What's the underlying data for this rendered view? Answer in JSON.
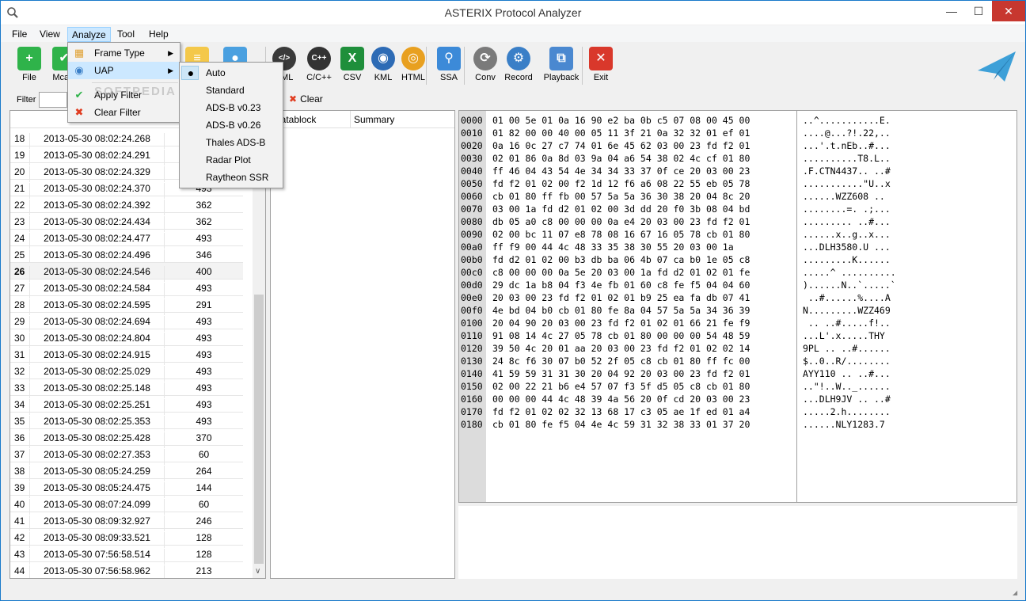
{
  "window": {
    "title": "ASTERIX Protocol Analyzer",
    "minimize": "—",
    "maximize": "☐",
    "close": "✕"
  },
  "menu": [
    "File",
    "View",
    "Analyze",
    "Tool",
    "Help"
  ],
  "toolbar": [
    {
      "label": "File",
      "color": "#2fb34a",
      "glyph": "+"
    },
    {
      "label": "Mcast",
      "color": "#2fb34a",
      "glyph": "✔"
    },
    {
      "label": "",
      "color": "#f4c84a",
      "glyph": "≡"
    },
    {
      "label": "",
      "color": "#4aa0e0",
      "glyph": "●"
    },
    {
      "label": "XML",
      "color": "#3a3a3a",
      "glyph": "</>"
    },
    {
      "label": "C/C++",
      "color": "#333333",
      "glyph": "C++"
    },
    {
      "label": "CSV",
      "color": "#1f8f3b",
      "glyph": "X"
    },
    {
      "label": "KML",
      "color": "#2d6bb5",
      "glyph": "◉"
    },
    {
      "label": "HTML",
      "color": "#e8a020",
      "glyph": "◎"
    },
    {
      "label": "SSA",
      "color": "#3c8ad8",
      "glyph": "⚲"
    },
    {
      "label": "Conv",
      "color": "#7a7a7a",
      "glyph": "⟳"
    },
    {
      "label": "Record",
      "color": "#3a7fc7",
      "glyph": "⚙"
    },
    {
      "label": "Playback",
      "color": "#4a88d0",
      "glyph": "⧉"
    },
    {
      "label": "Exit",
      "color": "#d9382b",
      "glyph": "✕"
    }
  ],
  "filter": {
    "label": "Filter",
    "value": "",
    "clear_label": "Clear"
  },
  "packet_table": {
    "rows": [
      [
        "18",
        "2013-05-30 08:02:24.268",
        ""
      ],
      [
        "19",
        "2013-05-30 08:02:24.291",
        ""
      ],
      [
        "20",
        "2013-05-30 08:02:24.329",
        ""
      ],
      [
        "21",
        "2013-05-30 08:02:24.370",
        "493"
      ],
      [
        "22",
        "2013-05-30 08:02:24.392",
        "362"
      ],
      [
        "23",
        "2013-05-30 08:02:24.434",
        "362"
      ],
      [
        "24",
        "2013-05-30 08:02:24.477",
        "493"
      ],
      [
        "25",
        "2013-05-30 08:02:24.496",
        "346"
      ],
      [
        "26",
        "2013-05-30 08:02:24.546",
        "400"
      ],
      [
        "27",
        "2013-05-30 08:02:24.584",
        "493"
      ],
      [
        "28",
        "2013-05-30 08:02:24.595",
        "291"
      ],
      [
        "29",
        "2013-05-30 08:02:24.694",
        "493"
      ],
      [
        "30",
        "2013-05-30 08:02:24.804",
        "493"
      ],
      [
        "31",
        "2013-05-30 08:02:24.915",
        "493"
      ],
      [
        "32",
        "2013-05-30 08:02:25.029",
        "493"
      ],
      [
        "33",
        "2013-05-30 08:02:25.148",
        "493"
      ],
      [
        "34",
        "2013-05-30 08:02:25.251",
        "493"
      ],
      [
        "35",
        "2013-05-30 08:02:25.353",
        "493"
      ],
      [
        "36",
        "2013-05-30 08:02:25.428",
        "370"
      ],
      [
        "37",
        "2013-05-30 08:02:27.353",
        "60"
      ],
      [
        "38",
        "2013-05-30 08:05:24.259",
        "264"
      ],
      [
        "39",
        "2013-05-30 08:05:24.475",
        "144"
      ],
      [
        "40",
        "2013-05-30 08:07:24.099",
        "60"
      ],
      [
        "41",
        "2013-05-30 08:09:32.927",
        "246"
      ],
      [
        "42",
        "2013-05-30 08:09:33.521",
        "128"
      ],
      [
        "43",
        "2013-05-30 07:56:58.514",
        "128"
      ],
      [
        "44",
        "2013-05-30 07:56:58.962",
        "213"
      ]
    ],
    "selected": "26"
  },
  "datablock_table": {
    "headers": [
      "Datablock",
      "Summary"
    ]
  },
  "hexdump": [
    [
      "0000",
      "01 00 5e 01 0a 16 90 e2 ba 0b c5 07 08 00 45 00",
      "..^...........E."
    ],
    [
      "0010",
      "01 82 00 00 40 00 05 11 3f 21 0a 32 32 01 ef 01",
      "....@...?!.22,.."
    ],
    [
      "0020",
      "0a 16 0c 27 c7 74 01 6e 45 62 03 00 23 fd f2 01",
      "...'.t.nEb..#..."
    ],
    [
      "0030",
      "02 01 86 0a 8d 03 9a 04 a6 54 38 02 4c cf 01 80",
      "..........T8.L.."
    ],
    [
      "0040",
      "ff 46 04 43 54 4e 34 34 33 37 0f ce 20 03 00 23",
      ".F.CTN4437.. ..#"
    ],
    [
      "0050",
      "fd f2 01 02 00 f2 1d 12 f6 a6 08 22 55 eb 05 78",
      "...........\"U..x"
    ],
    [
      "0060",
      "cb 01 80 ff fb 00 57 5a 5a 36 30 38 20 04 8c 20",
      "......WZZ608 .. "
    ],
    [
      "0070",
      "03 00 1a fd d2 01 02 00 3d dd 20 f0 3b 08 04 bd",
      "........=. .;..."
    ],
    [
      "0080",
      "db 05 a0 c8 00 00 00 0a e4 20 03 00 23 fd f2 01",
      "......... ..#..."
    ],
    [
      "0090",
      "02 00 bc 11 07 e8 78 08 16 67 16 05 78 cb 01 80",
      "......x..g..x..."
    ],
    [
      "00a0",
      "ff f9 00 44 4c 48 33 35 38 30 55 20 03 00 1a",
      "...DLH3580.U ..."
    ],
    [
      "00b0",
      "fd d2 01 02 00 b3 db ba 06 4b 07 ca b0 1e 05 c8",
      ".........K......"
    ],
    [
      "00c0",
      "c8 00 00 00 0a 5e 20 03 00 1a fd d2 01 02 01 fe",
      ".....^ .........."
    ],
    [
      "00d0",
      "29 dc 1a b8 04 f3 4e fb 01 60 c8 fe f5 04 04 60",
      ")......N..`.....`"
    ],
    [
      "00e0",
      "20 03 00 23 fd f2 01 02 01 b9 25 ea fa db 07 41",
      " ..#......%....A"
    ],
    [
      "00f0",
      "4e bd 04 b0 cb 01 80 fe 8a 04 57 5a 5a 34 36 39",
      "N.........WZZ469"
    ],
    [
      "0100",
      "20 04 90 20 03 00 23 fd f2 01 02 01 66 21 fe f9",
      " .. ..#.....f!.."
    ],
    [
      "0110",
      "91 08 14 4c 27 05 78 cb 01 80 00 00 00 54 48 59",
      "...L'.x.....THY"
    ],
    [
      "0120",
      "39 50 4c 20 01 aa 20 03 00 23 fd f2 01 02 02 14",
      "9PL .. ..#......"
    ],
    [
      "0130",
      "24 8c f6 30 07 b0 52 2f 05 c8 cb 01 80 ff fc 00",
      "$..0..R/........"
    ],
    [
      "0140",
      "41 59 59 31 31 30 20 04 92 20 03 00 23 fd f2 01",
      "AYY110 .. ..#..."
    ],
    [
      "0150",
      "02 00 22 21 b6 e4 57 07 f3 5f d5 05 c8 cb 01 80",
      "..\"!..W.._......"
    ],
    [
      "0160",
      "00 00 00 44 4c 48 39 4a 56 20 0f cd 20 03 00 23",
      "...DLH9JV .. ..#"
    ],
    [
      "0170",
      "fd f2 01 02 02 32 13 68 17 c3 05 ae 1f ed 01 a4",
      ".....2.h........"
    ],
    [
      "0180",
      "cb 01 80 fe f5 04 4e 4c 59 31 32 38 33 01 37 20",
      "......NLY1283.7 "
    ]
  ],
  "analyze_menu": {
    "items": [
      {
        "label": "Frame Type",
        "icon": "frame-type-icon",
        "submenu": true
      },
      {
        "label": "UAP",
        "icon": "uap-icon",
        "submenu": true
      },
      {
        "label": "Apply Filter",
        "icon": "check-icon",
        "submenu": false
      },
      {
        "label": "Clear Filter",
        "icon": "x-icon",
        "submenu": false
      }
    ]
  },
  "uap_menu": {
    "items": [
      "Auto",
      "Standard",
      "ADS-B v0.23",
      "ADS-B v0.26",
      "Thales ADS-B",
      "Radar Plot",
      "Raytheon SSR"
    ],
    "checked": "Auto"
  },
  "watermark": "SOFTPEDIA"
}
